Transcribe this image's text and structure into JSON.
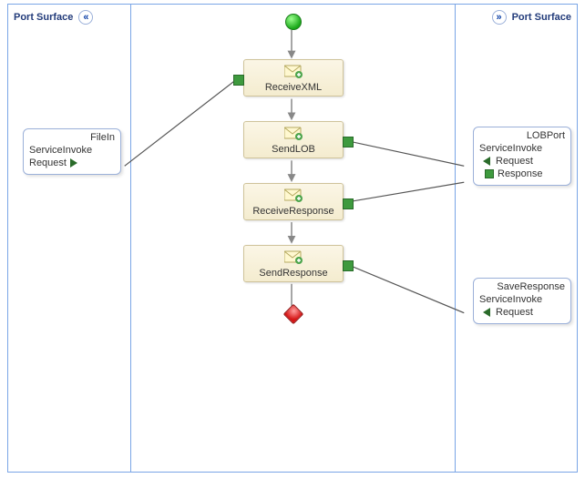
{
  "surface_label": "Port Surface",
  "shapes": {
    "receive_xml": {
      "label": "ReceiveXML"
    },
    "send_lob": {
      "label": "SendLOB"
    },
    "receive_response": {
      "label": "ReceiveResponse"
    },
    "send_response": {
      "label": "SendResponse"
    }
  },
  "ports": {
    "file_in": {
      "name": "FileIn",
      "operation": "ServiceInvoke",
      "messages": {
        "request": "Request"
      }
    },
    "lob_port": {
      "name": "LOBPort",
      "operation": "ServiceInvoke",
      "messages": {
        "request": "Request",
        "response": "Response"
      }
    },
    "save_response": {
      "name": "SaveResponse",
      "operation": "ServiceInvoke",
      "messages": {
        "request": "Request"
      }
    }
  }
}
